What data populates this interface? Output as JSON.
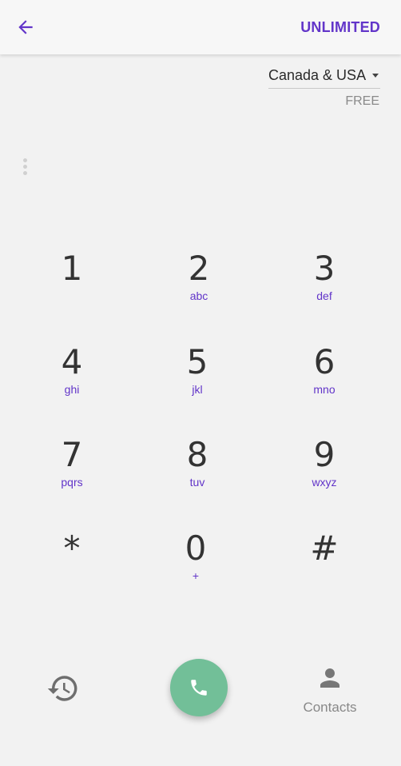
{
  "header": {
    "back_icon": "arrow-left-icon",
    "plan_label": "UNLIMITED"
  },
  "destination": {
    "selected": "Canada & USA",
    "rate": "FREE"
  },
  "keypad": [
    {
      "digit": "1",
      "sub": ""
    },
    {
      "digit": "2",
      "sub": "abc"
    },
    {
      "digit": "3",
      "sub": "def"
    },
    {
      "digit": "4",
      "sub": "ghi"
    },
    {
      "digit": "5",
      "sub": "jkl"
    },
    {
      "digit": "6",
      "sub": "mno"
    },
    {
      "digit": "7",
      "sub": "pqrs"
    },
    {
      "digit": "8",
      "sub": "tuv"
    },
    {
      "digit": "9",
      "sub": "wxyz"
    },
    {
      "digit": "*",
      "sub": ""
    },
    {
      "digit": "0",
      "sub": "+"
    },
    {
      "digit": "#",
      "sub": ""
    }
  ],
  "bottom": {
    "history_icon": "history-icon",
    "call_icon": "phone-icon",
    "contacts_icon": "person-icon",
    "contacts_label": "Contacts"
  },
  "colors": {
    "accent": "#6235c9",
    "call_button": "#72bf98",
    "background": "#f2f2f2"
  }
}
